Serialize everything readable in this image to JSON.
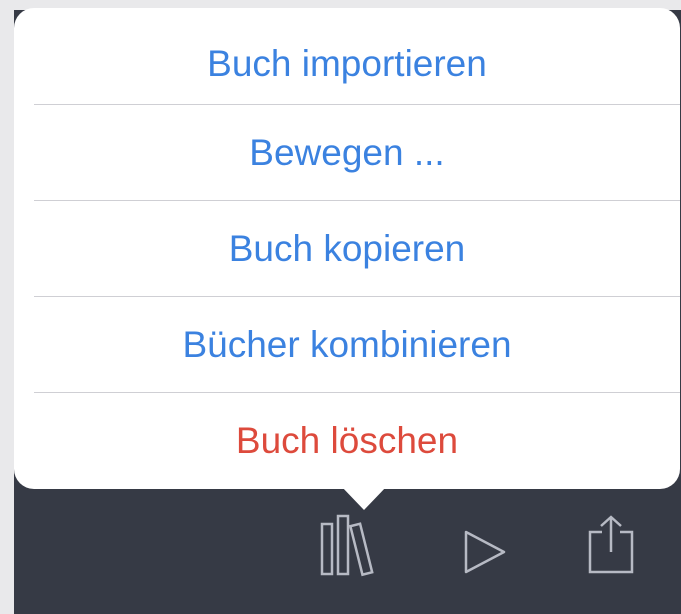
{
  "menu": {
    "items": [
      {
        "label": "Buch importieren",
        "style": "default"
      },
      {
        "label": "Bewegen ...",
        "style": "default"
      },
      {
        "label": "Buch kopieren",
        "style": "default"
      },
      {
        "label": "Bücher kombinieren",
        "style": "default"
      },
      {
        "label": "Buch löschen",
        "style": "destructive"
      }
    ]
  },
  "toolbar": {
    "icons": [
      "library-icon",
      "play-icon",
      "share-icon"
    ]
  },
  "colors": {
    "action_blue": "#3b82e0",
    "destructive_red": "#dd4a3c",
    "toolbar_background": "#363a45",
    "icon_gray": "#b7bac4"
  }
}
